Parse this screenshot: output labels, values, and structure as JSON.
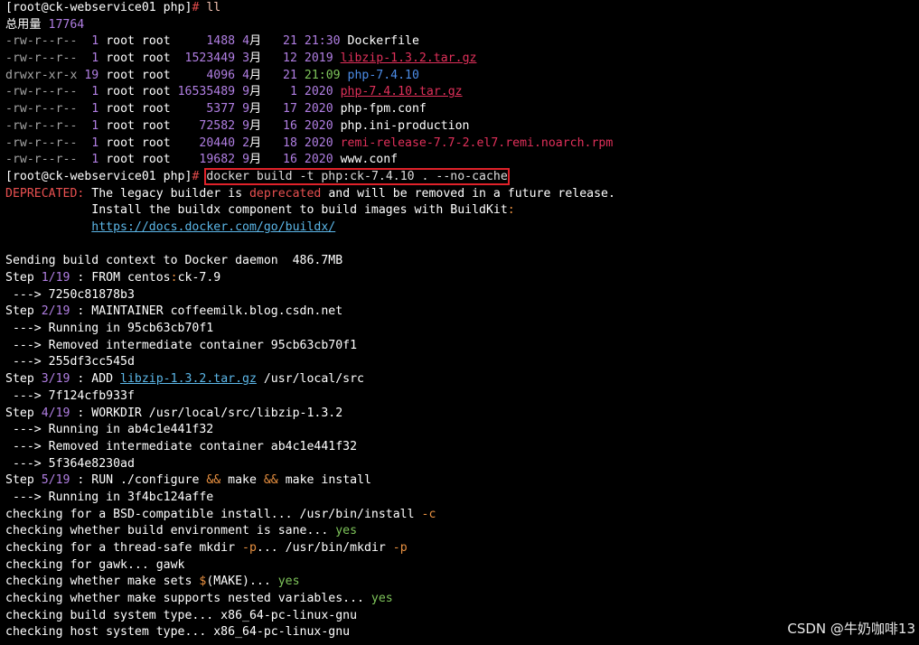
{
  "colors": {
    "default": "#ffffff",
    "prompt_hash": "#e04a4a",
    "perm": "#a4a4a4",
    "num": "#b07ee2",
    "exec": "#7ec45a",
    "dir": "#4c8ce6",
    "archive": "#e0305a",
    "error": "#e85050",
    "link": "#5cb7e8",
    "path": "#8ab4f8",
    "warn": "#e89040",
    "cmd": "#dddddd",
    "cmd_flag": "#f2c0b0"
  },
  "watermark": "CSDN @牛奶咖啡13",
  "lines": [
    {
      "segs": [
        {
          "t": "[root@ck-webservice01 php]"
        },
        {
          "t": "# ",
          "c": "prompt_hash"
        },
        {
          "t": "ll",
          "c": "cmd_flag"
        }
      ]
    },
    {
      "segs": [
        {
          "t": "总用量 "
        },
        {
          "t": "17764",
          "c": "num"
        }
      ]
    },
    {
      "segs": [
        {
          "t": "-rw-r--r--",
          "c": "perm"
        },
        {
          "t": "  "
        },
        {
          "t": "1",
          "c": "num"
        },
        {
          "t": " root root     "
        },
        {
          "t": "1488",
          "c": "num"
        },
        {
          "t": " "
        },
        {
          "t": "4",
          "c": "num"
        },
        {
          "t": "月   "
        },
        {
          "t": "21",
          "c": "num"
        },
        {
          "t": " "
        },
        {
          "t": "21:30",
          "c": "num"
        },
        {
          "t": " Dockerfile"
        }
      ]
    },
    {
      "segs": [
        {
          "t": "-rw-r--r--",
          "c": "perm"
        },
        {
          "t": "  "
        },
        {
          "t": "1",
          "c": "num"
        },
        {
          "t": " root root  "
        },
        {
          "t": "1523449",
          "c": "num"
        },
        {
          "t": " "
        },
        {
          "t": "3",
          "c": "num"
        },
        {
          "t": "月   "
        },
        {
          "t": "12",
          "c": "num"
        },
        {
          "t": " "
        },
        {
          "t": "2019",
          "c": "num"
        },
        {
          "t": " "
        },
        {
          "t": "libzip-1.3.2.tar.gz",
          "c": "archive",
          "u": true
        }
      ]
    },
    {
      "segs": [
        {
          "t": "drwxr-xr-x",
          "c": "perm"
        },
        {
          "t": " "
        },
        {
          "t": "19",
          "c": "num"
        },
        {
          "t": " root root     "
        },
        {
          "t": "4096",
          "c": "num"
        },
        {
          "t": " "
        },
        {
          "t": "4",
          "c": "num"
        },
        {
          "t": "月   "
        },
        {
          "t": "21",
          "c": "num"
        },
        {
          "t": " "
        },
        {
          "t": "21:09",
          "c": "exec"
        },
        {
          "t": " "
        },
        {
          "t": "php-7.4.10",
          "c": "dir"
        }
      ]
    },
    {
      "segs": [
        {
          "t": "-rw-r--r--",
          "c": "perm"
        },
        {
          "t": "  "
        },
        {
          "t": "1",
          "c": "num"
        },
        {
          "t": " root root "
        },
        {
          "t": "16535489",
          "c": "num"
        },
        {
          "t": " "
        },
        {
          "t": "9",
          "c": "num"
        },
        {
          "t": "月    "
        },
        {
          "t": "1",
          "c": "num"
        },
        {
          "t": " "
        },
        {
          "t": "2020",
          "c": "num"
        },
        {
          "t": " "
        },
        {
          "t": "php-7.4.10.tar.gz",
          "c": "archive",
          "u": true
        }
      ]
    },
    {
      "segs": [
        {
          "t": "-rw-r--r--",
          "c": "perm"
        },
        {
          "t": "  "
        },
        {
          "t": "1",
          "c": "num"
        },
        {
          "t": " root root     "
        },
        {
          "t": "5377",
          "c": "num"
        },
        {
          "t": " "
        },
        {
          "t": "9",
          "c": "num"
        },
        {
          "t": "月   "
        },
        {
          "t": "17",
          "c": "num"
        },
        {
          "t": " "
        },
        {
          "t": "2020",
          "c": "num"
        },
        {
          "t": " php-fpm.conf"
        }
      ]
    },
    {
      "segs": [
        {
          "t": "-rw-r--r--",
          "c": "perm"
        },
        {
          "t": "  "
        },
        {
          "t": "1",
          "c": "num"
        },
        {
          "t": " root root    "
        },
        {
          "t": "72582",
          "c": "num"
        },
        {
          "t": " "
        },
        {
          "t": "9",
          "c": "num"
        },
        {
          "t": "月   "
        },
        {
          "t": "16",
          "c": "num"
        },
        {
          "t": " "
        },
        {
          "t": "2020",
          "c": "num"
        },
        {
          "t": " php.ini-production"
        }
      ]
    },
    {
      "segs": [
        {
          "t": "-rw-r--r--",
          "c": "perm"
        },
        {
          "t": "  "
        },
        {
          "t": "1",
          "c": "num"
        },
        {
          "t": " root root    "
        },
        {
          "t": "20440",
          "c": "num"
        },
        {
          "t": " "
        },
        {
          "t": "2",
          "c": "num"
        },
        {
          "t": "月   "
        },
        {
          "t": "18",
          "c": "num"
        },
        {
          "t": " "
        },
        {
          "t": "2020",
          "c": "num"
        },
        {
          "t": " "
        },
        {
          "t": "remi-release-7.7-2.el7.remi.noarch.rpm",
          "c": "archive"
        }
      ]
    },
    {
      "segs": [
        {
          "t": "-rw-r--r--",
          "c": "perm"
        },
        {
          "t": "  "
        },
        {
          "t": "1",
          "c": "num"
        },
        {
          "t": " root root    "
        },
        {
          "t": "19682",
          "c": "num"
        },
        {
          "t": " "
        },
        {
          "t": "9",
          "c": "num"
        },
        {
          "t": "月   "
        },
        {
          "t": "16",
          "c": "num"
        },
        {
          "t": " "
        },
        {
          "t": "2020",
          "c": "num"
        },
        {
          "t": " www.conf"
        }
      ]
    },
    {
      "segs": [
        {
          "t": "[root@ck-webservice01 php]"
        },
        {
          "t": "# ",
          "c": "prompt_hash"
        },
        {
          "t": "docker build -t php:ck-7.4.10 . --no-cache",
          "c": "cmd",
          "box": true
        }
      ]
    },
    {
      "segs": [
        {
          "t": "DEPRECATED:",
          "c": "error"
        },
        {
          "t": " The legacy builder is "
        },
        {
          "t": "deprecated",
          "c": "error"
        },
        {
          "t": " and will be removed in a future release."
        }
      ]
    },
    {
      "segs": [
        {
          "t": "            Install the buildx component to build images with BuildKit"
        },
        {
          "t": ":",
          "c": "warn"
        }
      ]
    },
    {
      "segs": [
        {
          "t": "            "
        },
        {
          "t": "https://docs.docker.com/go/buildx/",
          "c": "link",
          "u": true
        }
      ]
    },
    {
      "segs": [
        {
          "t": ""
        }
      ]
    },
    {
      "segs": [
        {
          "t": "Sending build context to Docker daemon  486.7MB"
        }
      ]
    },
    {
      "segs": [
        {
          "t": "Step "
        },
        {
          "t": "1/19",
          "c": "num"
        },
        {
          "t": " : FROM centos"
        },
        {
          "t": ":",
          "c": "warn"
        },
        {
          "t": "ck-7.9"
        }
      ]
    },
    {
      "segs": [
        {
          "t": " ---> 7250c81878b3"
        }
      ]
    },
    {
      "segs": [
        {
          "t": "Step "
        },
        {
          "t": "2/19",
          "c": "num"
        },
        {
          "t": " : MAINTAINER coffeemilk.blog.csdn.net"
        }
      ]
    },
    {
      "segs": [
        {
          "t": " ---> Running in 95cb63cb70f1"
        }
      ]
    },
    {
      "segs": [
        {
          "t": " ---> Removed intermediate container 95cb63cb70f1"
        }
      ]
    },
    {
      "segs": [
        {
          "t": " ---> 255df3cc545d"
        }
      ]
    },
    {
      "segs": [
        {
          "t": "Step "
        },
        {
          "t": "3/19",
          "c": "num"
        },
        {
          "t": " : ADD "
        },
        {
          "t": "libzip-1.3.2.tar.gz",
          "c": "link",
          "u": true
        },
        {
          "t": " /usr/local/src"
        }
      ]
    },
    {
      "segs": [
        {
          "t": " ---> 7f124cfb933f"
        }
      ]
    },
    {
      "segs": [
        {
          "t": "Step "
        },
        {
          "t": "4/19",
          "c": "num"
        },
        {
          "t": " : WORKDIR /usr/local/src/libzip-1.3.2"
        }
      ]
    },
    {
      "segs": [
        {
          "t": " ---> Running in ab4c1e441f32"
        }
      ]
    },
    {
      "segs": [
        {
          "t": " ---> Removed intermediate container ab4c1e441f32"
        }
      ]
    },
    {
      "segs": [
        {
          "t": " ---> 5f364e8230ad"
        }
      ]
    },
    {
      "segs": [
        {
          "t": "Step "
        },
        {
          "t": "5/19",
          "c": "num"
        },
        {
          "t": " : RUN ./configure "
        },
        {
          "t": "&&",
          "c": "warn"
        },
        {
          "t": " make "
        },
        {
          "t": "&&",
          "c": "warn"
        },
        {
          "t": " make install"
        }
      ]
    },
    {
      "segs": [
        {
          "t": " ---> Running in 3f4bc124affe"
        }
      ]
    },
    {
      "segs": [
        {
          "t": "checking for a BSD-compatible install... /usr/bin/install "
        },
        {
          "t": "-c",
          "c": "warn"
        }
      ]
    },
    {
      "segs": [
        {
          "t": "checking whether build environment is sane... "
        },
        {
          "t": "yes",
          "c": "exec"
        }
      ]
    },
    {
      "segs": [
        {
          "t": "checking for a thread-safe mkdir "
        },
        {
          "t": "-p",
          "c": "warn"
        },
        {
          "t": "... /usr/bin/mkdir "
        },
        {
          "t": "-p",
          "c": "warn"
        }
      ]
    },
    {
      "segs": [
        {
          "t": "checking for gawk... gawk"
        }
      ]
    },
    {
      "segs": [
        {
          "t": "checking whether make sets "
        },
        {
          "t": "$",
          "c": "warn"
        },
        {
          "t": "(MAKE)... "
        },
        {
          "t": "yes",
          "c": "exec"
        }
      ]
    },
    {
      "segs": [
        {
          "t": "checking whether make supports nested variables... "
        },
        {
          "t": "yes",
          "c": "exec"
        }
      ]
    },
    {
      "segs": [
        {
          "t": "checking build system type... x86_64-pc-linux-gnu"
        }
      ]
    },
    {
      "segs": [
        {
          "t": "checking host system type... x86_64-pc-linux-gnu"
        }
      ]
    }
  ]
}
